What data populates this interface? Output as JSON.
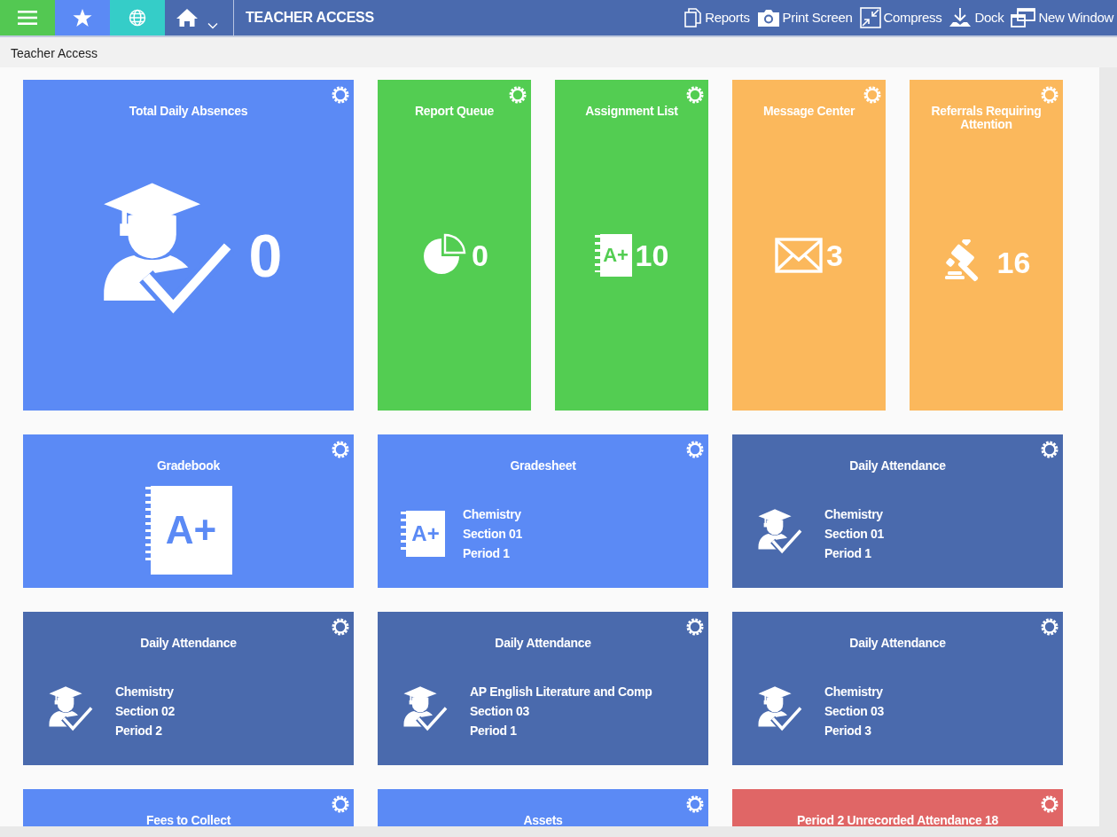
{
  "toolbar": {
    "buttons": [
      {
        "kind": "menu",
        "color": "#53c852"
      },
      {
        "kind": "favorites",
        "color": "#5b8af5"
      },
      {
        "kind": "globe",
        "color": "#35cdc8"
      },
      {
        "kind": "home",
        "color": "#4a6aae"
      }
    ],
    "title": "TEACHER ACCESS",
    "actions": [
      {
        "kind": "reports",
        "label": "Reports"
      },
      {
        "kind": "print",
        "label": "Print Screen"
      },
      {
        "kind": "compress",
        "label": "Compress"
      },
      {
        "kind": "dock",
        "label": "Dock"
      },
      {
        "kind": "window",
        "label": "New Window"
      }
    ]
  },
  "breadcrumb": "Teacher Access",
  "tiles": [
    {
      "title": "Total Daily Absences",
      "kind": "absences",
      "count": "0",
      "color": "#5b8af5"
    },
    {
      "title": "Report Queue",
      "kind": "queue",
      "count": "0",
      "color": "#53cd52"
    },
    {
      "title": "Assignment List",
      "kind": "assignments",
      "icon_text": "A+",
      "count": "10",
      "color": "#53cd52"
    },
    {
      "title": "Message Center",
      "kind": "messages",
      "count": "3",
      "color": "#fbb85c"
    },
    {
      "title": "Referrals Requiring Attention",
      "kind": "referrals",
      "count": "16",
      "color": "#fbb85c"
    },
    {
      "title": "Gradebook",
      "kind": "gradebook",
      "icon_text": "A+",
      "color": "#5b8af5"
    },
    {
      "title": "Gradesheet",
      "kind": "gradesheet",
      "icon_text": "A+",
      "lines": [
        "Chemistry",
        "Section 01",
        "Period 1"
      ],
      "color": "#5b8af5"
    },
    {
      "title": "Daily Attendance",
      "kind": "attendance",
      "lines": [
        "Chemistry",
        "Section 01",
        "Period 1"
      ],
      "color": "#4a6aad"
    },
    {
      "title": "Daily Attendance",
      "kind": "attendance",
      "lines": [
        "Chemistry",
        "Section 02",
        "Period 2"
      ],
      "color": "#4a6aad"
    },
    {
      "title": "Daily Attendance",
      "kind": "attendance",
      "lines": [
        "AP English Literature and Comp",
        "Section 03",
        "Period 1"
      ],
      "color": "#4a6aad"
    },
    {
      "title": "Daily Attendance",
      "kind": "attendance",
      "lines": [
        "Chemistry",
        "Section 03",
        "Period 3"
      ],
      "color": "#4a6aad"
    },
    {
      "title": "Fees to Collect",
      "kind": "summary",
      "color": "#5b8af5"
    },
    {
      "title": "Assets",
      "kind": "summary",
      "color": "#5b8af5"
    },
    {
      "title": "Period 2 Unrecorded Attendance 18",
      "kind": "summary",
      "color": "#e06666"
    }
  ]
}
